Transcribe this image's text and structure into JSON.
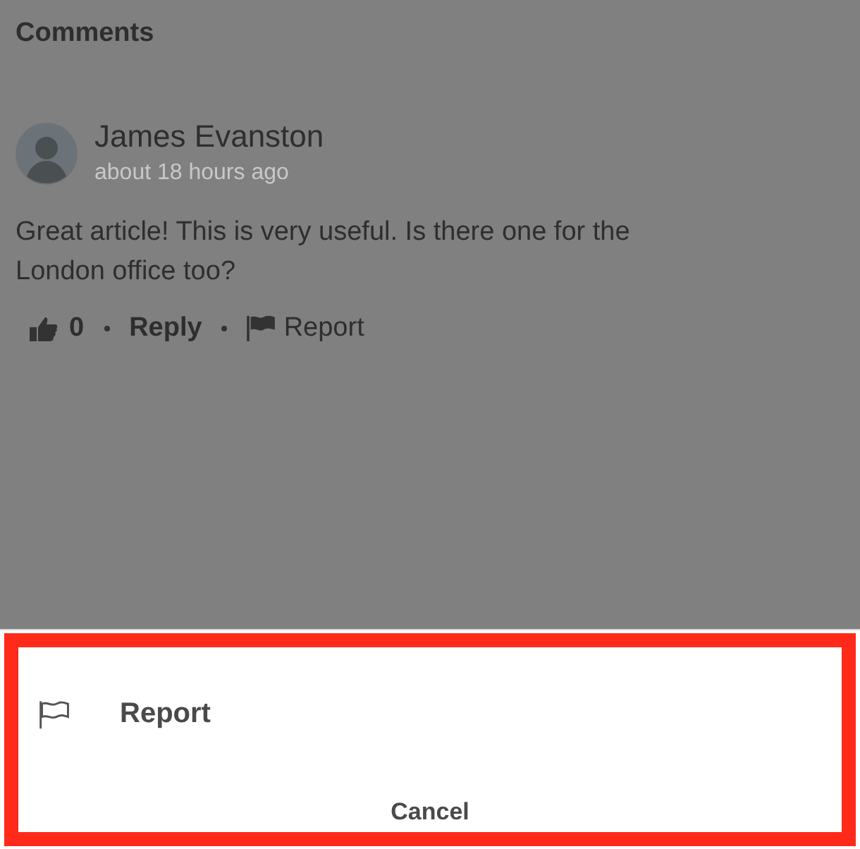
{
  "section_title": "Comments",
  "comment": {
    "author": "James Evanston",
    "time": "about 18 hours ago",
    "body": "Great article! This is very useful. Is there one for the London office too?",
    "likes": "0",
    "reply": "Reply",
    "report": "Report"
  },
  "action_sheet": {
    "actions": [
      {
        "label": "Report",
        "kind": "flag"
      }
    ],
    "cancel": "Cancel"
  }
}
